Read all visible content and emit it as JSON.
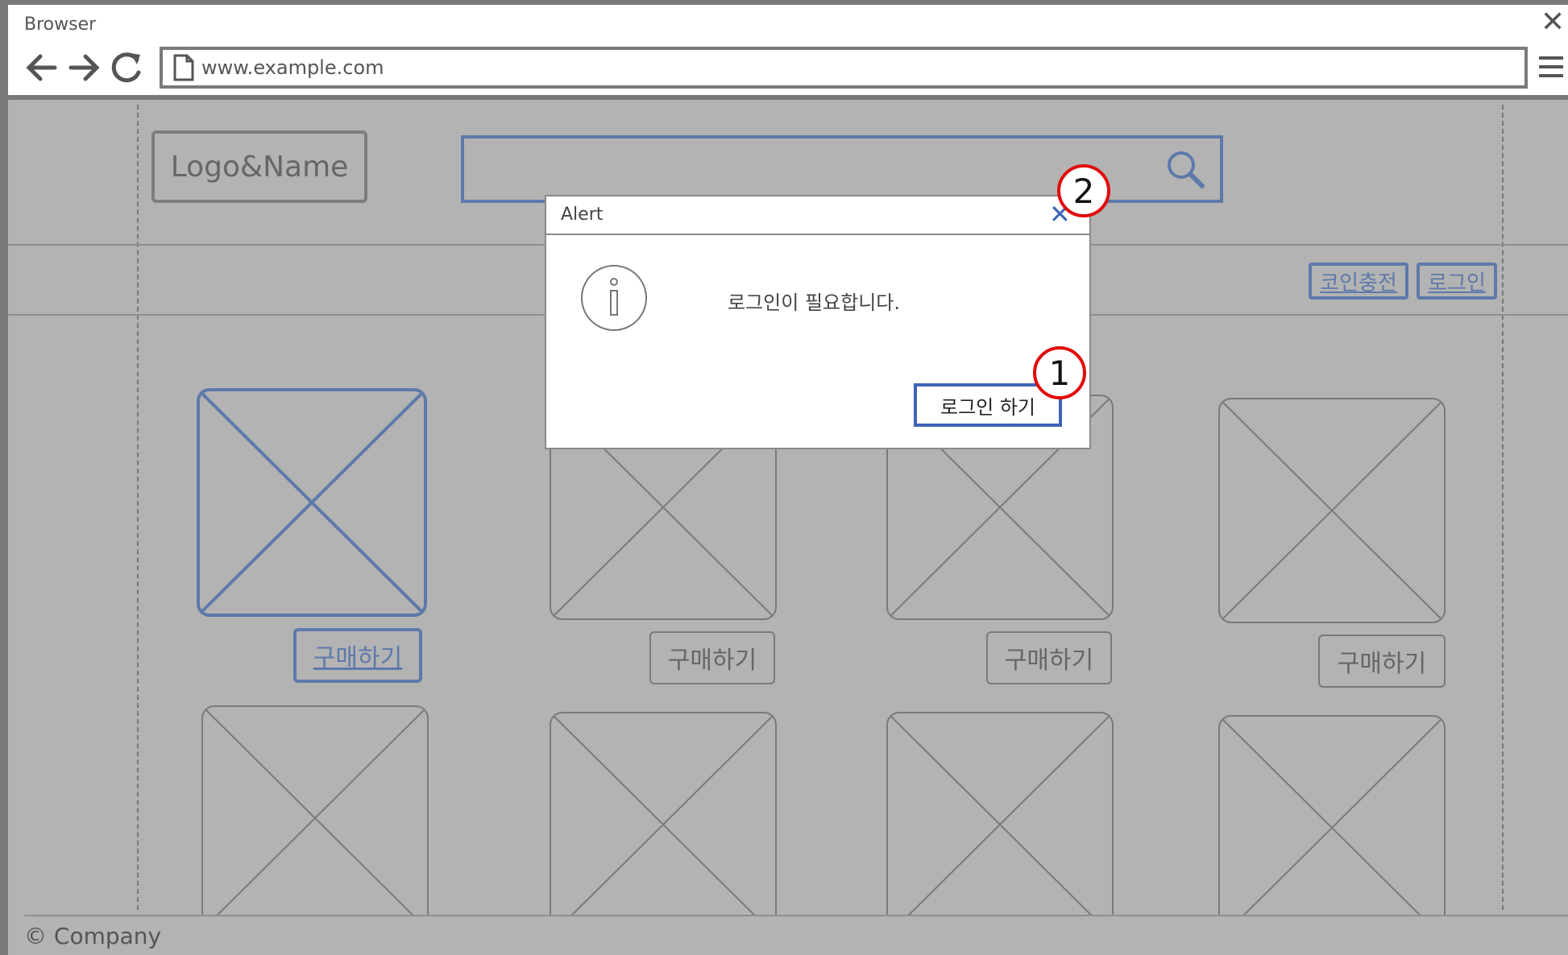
{
  "browser": {
    "title": "Browser",
    "close_glyph": "✕",
    "url": "www.example.com",
    "icons": [
      "back-arrow-icon",
      "forward-arrow-icon",
      "reload-icon",
      "document-icon",
      "hamburger-menu-icon"
    ]
  },
  "header": {
    "logo_text": "Logo&Name",
    "search_icon": "search-icon"
  },
  "topnav": {
    "coin_charge_label": "코인충전",
    "login_label": "로그인"
  },
  "products": {
    "buy_label": "구매하기",
    "row1_count": 4,
    "row2_count": 4
  },
  "footer": {
    "text": "© Company"
  },
  "modal": {
    "title": "Alert",
    "close_glyph": "✕",
    "message": "로그인이 필요합니다.",
    "login_button_label": "로그인 하기",
    "icon": "info-icon"
  },
  "callouts": {
    "one": "1",
    "two": "2"
  },
  "colors": {
    "accent_blue": "#5e79aa",
    "modal_blue": "#3f63b8",
    "callout_red": "#e10b0b",
    "overlay_gray": "#b3b3b3"
  }
}
